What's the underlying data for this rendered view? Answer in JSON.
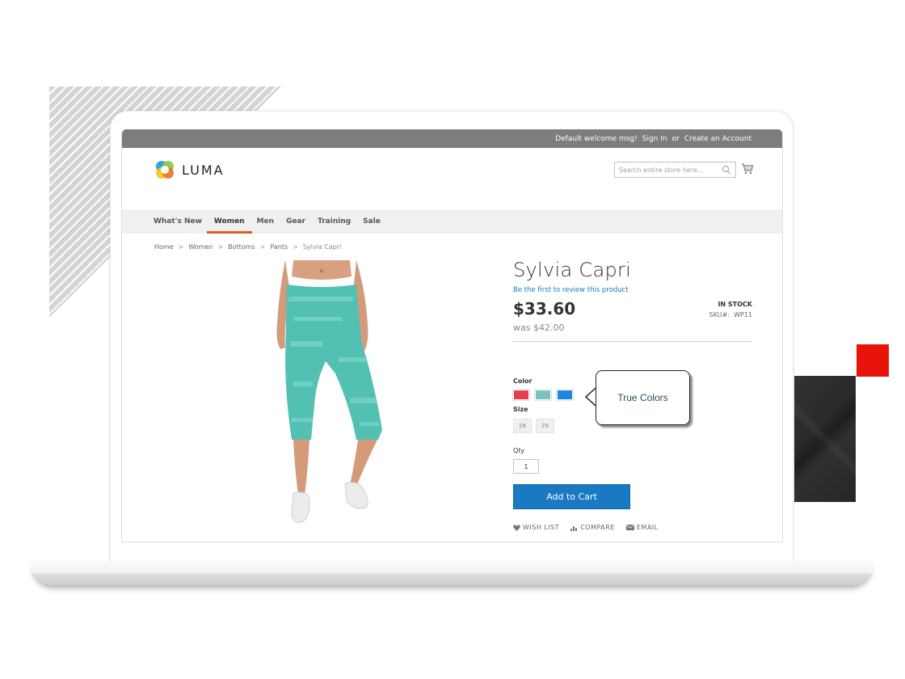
{
  "topbar": {
    "welcome": "Default welcome msg!",
    "sign_in": "Sign In",
    "or": "or",
    "create_account": "Create an Account"
  },
  "brand": {
    "name": "LUMA"
  },
  "search": {
    "placeholder": "Search entire store here...",
    "icon": "search-icon"
  },
  "cart": {
    "icon": "cart-icon"
  },
  "nav": {
    "items": [
      {
        "label": "What's New",
        "active": false
      },
      {
        "label": "Women",
        "active": true
      },
      {
        "label": "Men",
        "active": false
      },
      {
        "label": "Gear",
        "active": false
      },
      {
        "label": "Training",
        "active": false
      },
      {
        "label": "Sale",
        "active": false
      }
    ],
    "active_color": "#d4641e"
  },
  "breadcrumb": {
    "items": [
      "Home",
      "Women",
      "Bottoms",
      "Pants",
      "Sylvia Capri"
    ],
    "separator": ">"
  },
  "product": {
    "name": "Sylvia Capri",
    "review_link": "Be the first to review this product",
    "price": "$33.60",
    "old_price": "was $42.00",
    "stock": "IN STOCK",
    "sku_label": "SKU#:",
    "sku": "WP11",
    "color_label": "Color",
    "colors": [
      {
        "name": "Red",
        "hex": "#e8404b"
      },
      {
        "name": "Teal",
        "hex": "#7cc2bf"
      },
      {
        "name": "Blue",
        "hex": "#1a87e0"
      }
    ],
    "size_label": "Size",
    "sizes": [
      "28",
      "29"
    ],
    "qty_label": "Qty",
    "qty_value": "1",
    "add_to_cart": "Add to Cart",
    "actions": [
      {
        "label": "WISH LIST",
        "icon": "heart-icon"
      },
      {
        "label": "COMPARE",
        "icon": "compare-icon"
      },
      {
        "label": "EMAIL",
        "icon": "envelope-icon"
      }
    ]
  },
  "callout": {
    "text": "True Colors"
  },
  "colors": {
    "topbar": "#7d7d7d",
    "primary_button": "#1979c3",
    "accent_red": "#e8140a"
  }
}
